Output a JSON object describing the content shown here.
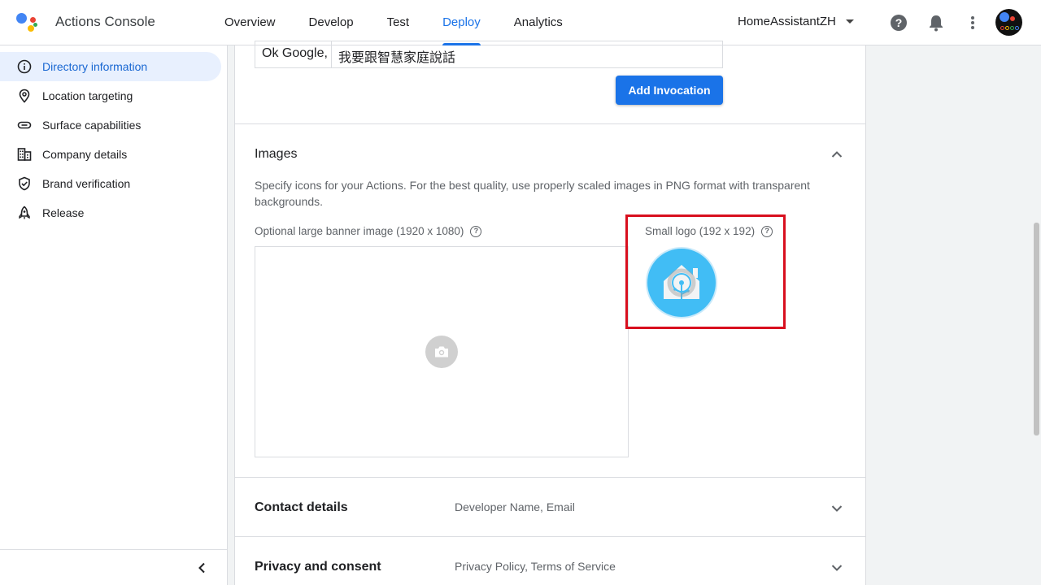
{
  "app": {
    "title": "Actions Console"
  },
  "nav": {
    "tabs": [
      {
        "label": "Overview"
      },
      {
        "label": "Develop"
      },
      {
        "label": "Test"
      },
      {
        "label": "Deploy"
      },
      {
        "label": "Analytics"
      }
    ],
    "active_tab": "Deploy"
  },
  "project": {
    "name": "HomeAssistantZH"
  },
  "sidebar": {
    "items": [
      {
        "label": "Directory information",
        "icon": "info-icon",
        "active": true
      },
      {
        "label": "Location targeting",
        "icon": "location-pin-icon"
      },
      {
        "label": "Surface capabilities",
        "icon": "link-icon"
      },
      {
        "label": "Company details",
        "icon": "building-icon"
      },
      {
        "label": "Brand verification",
        "icon": "shield-check-icon"
      },
      {
        "label": "Release",
        "icon": "rocket-icon"
      }
    ]
  },
  "invocation": {
    "prefix": "Ok Google,",
    "text": "我要跟智慧家庭說話",
    "add_button": "Add Invocation"
  },
  "images": {
    "title": "Images",
    "description": "Specify icons for your Actions. For the best quality, use properly scaled images in PNG format with transparent backgrounds.",
    "banner_label": "Optional large banner image (1920 x 1080)",
    "logo_label": "Small logo (192 x 192)"
  },
  "sections": [
    {
      "title": "Contact details",
      "summary": "Developer Name, Email"
    },
    {
      "title": "Privacy and consent",
      "summary": "Privacy Policy, Terms of Service"
    }
  ],
  "colors": {
    "accent": "#1a73e8",
    "highlight_box": "#d80f1e",
    "logo_bg": "#41bdf5"
  }
}
